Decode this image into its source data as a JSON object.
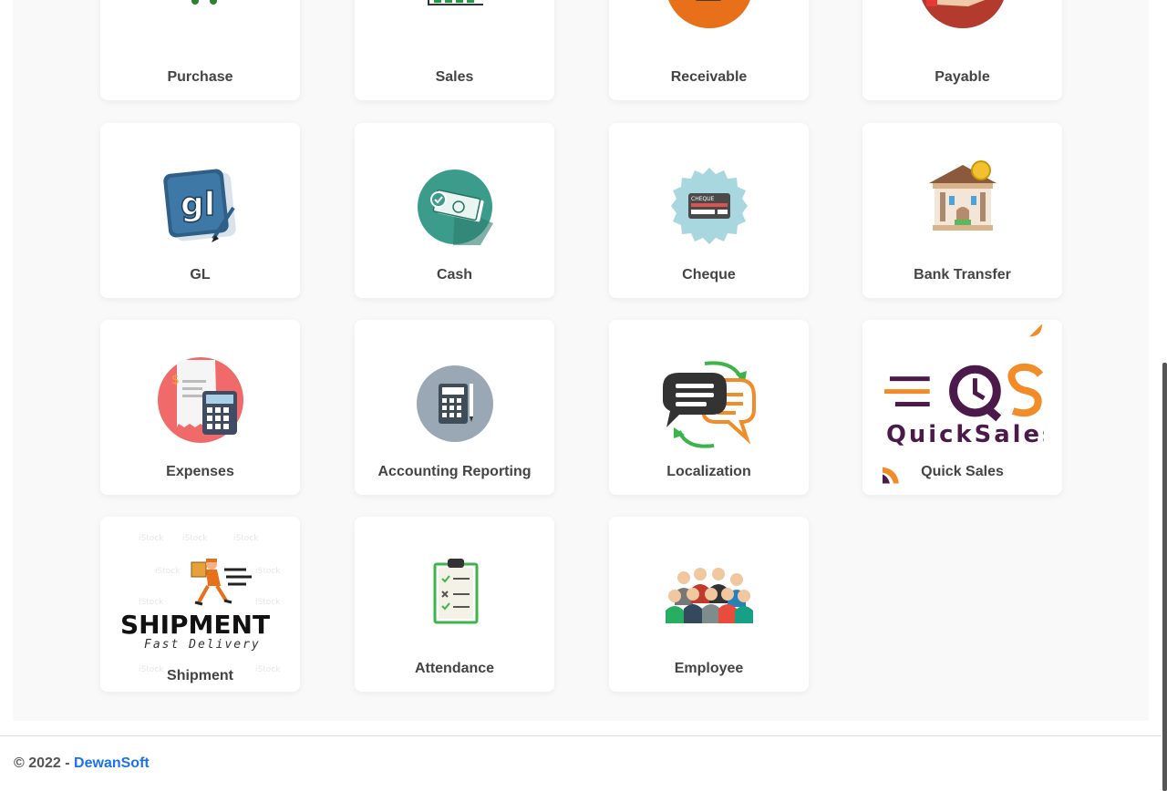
{
  "modules": [
    {
      "label": "Purchase",
      "icon": "shopping-cart-icon"
    },
    {
      "label": "Sales",
      "icon": "sales-chart-icon"
    },
    {
      "label": "Receivable",
      "icon": "wallet-receivable-icon"
    },
    {
      "label": "Payable",
      "icon": "hand-money-icon"
    },
    {
      "label": "GL",
      "icon": "gl-ledger-icon"
    },
    {
      "label": "Cash",
      "icon": "cash-banknote-icon"
    },
    {
      "label": "Cheque",
      "icon": "cheque-badge-icon"
    },
    {
      "label": "Bank Transfer",
      "icon": "bank-building-icon"
    },
    {
      "label": "Expenses",
      "icon": "receipt-calculator-icon"
    },
    {
      "label": "Accounting Reporting",
      "icon": "calculator-icon"
    },
    {
      "label": "Localization",
      "icon": "translation-chat-icon"
    },
    {
      "label": "Quick Sales",
      "icon": "quicksales-logo-icon"
    },
    {
      "label": "Shipment",
      "icon": "shipment-courier-icon"
    },
    {
      "label": "Attendance",
      "icon": "clipboard-checklist-icon"
    },
    {
      "label": "Employee",
      "icon": "people-group-icon"
    }
  ],
  "logo_text": {
    "gl": "gl",
    "cheque": "CHEQUE",
    "quicksales_word": "QuickSales",
    "shipment_word": "SHIPMENT",
    "shipment_tagline": "Fast Delivery"
  },
  "footer": {
    "copyright": "© 2022 - ",
    "brand": "DewanSoft"
  },
  "colors": {
    "page_bg": "#f9f9f9",
    "tile_bg": "#ffffff",
    "label": "#444444",
    "link": "#1a73e8"
  }
}
